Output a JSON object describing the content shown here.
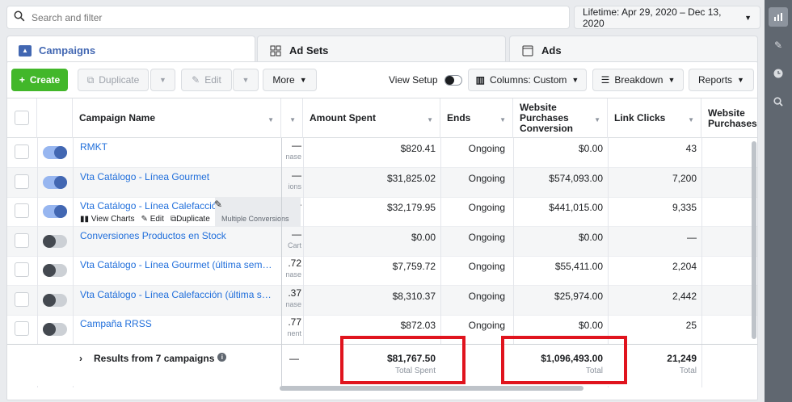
{
  "search": {
    "placeholder": "Search and filter"
  },
  "date_range": {
    "label": "Lifetime: Apr 29, 2020 – Dec 13, 2020"
  },
  "tabs": [
    {
      "label": "Campaigns",
      "icon": "folder-icon",
      "active": true
    },
    {
      "label": "Ad Sets",
      "icon": "grid-icon",
      "active": false
    },
    {
      "label": "Ads",
      "icon": "ad-icon",
      "active": false
    }
  ],
  "toolbar": {
    "create": "Create",
    "duplicate": "Duplicate",
    "edit": "Edit",
    "more": "More",
    "view_setup": "View Setup",
    "columns": "Columns: Custom",
    "breakdown": "Breakdown",
    "reports": "Reports"
  },
  "columns": {
    "campaign_name": "Campaign Name",
    "amount_spent": "Amount Spent",
    "ends": "Ends",
    "website_purchases_conversion": "Website Purchases Conversion",
    "link_clicks": "Link Clicks",
    "website_purchases": "Website Purchases"
  },
  "rows": [
    {
      "name": "RMKT",
      "frag_top": "—",
      "frag_bot": "nase",
      "amount_spent": "$820.41",
      "ends": "Ongoing",
      "conversion": "$0.00",
      "link_clicks": "43",
      "on": true
    },
    {
      "name": "Vta Catálogo - Línea Gourmet",
      "frag_top": "—",
      "frag_bot": "ions",
      "amount_spent": "$31,825.02",
      "ends": "Ongoing",
      "conversion": "$574,093.00",
      "link_clicks": "7,200",
      "on": true
    },
    {
      "name": "Vta Catálogo - Línea Calefacción",
      "frag_top": "—",
      "frag_bot": "",
      "amount_spent": "$32,179.95",
      "ends": "Ongoing",
      "conversion": "$441,015.00",
      "link_clicks": "9,335",
      "on": true
    },
    {
      "name": "Conversiones Productos en Stock",
      "frag_top": "—",
      "frag_bot": "Cart",
      "amount_spent": "$0.00",
      "ends": "Ongoing",
      "conversion": "$0.00",
      "link_clicks": "—",
      "on": false
    },
    {
      "name": "Vta Catálogo - Línea Gourmet (última seman...",
      "frag_top": ".72",
      "frag_bot": "nase",
      "amount_spent": "$7,759.72",
      "ends": "Ongoing",
      "conversion": "$55,411.00",
      "link_clicks": "2,204",
      "on": false
    },
    {
      "name": "Vta Catálogo - Línea Calefacción (última sem...",
      "frag_top": ".37",
      "frag_bot": "nase",
      "amount_spent": "$8,310.37",
      "ends": "Ongoing",
      "conversion": "$25,974.00",
      "link_clicks": "2,442",
      "on": false
    },
    {
      "name": "Campaña RRSS",
      "frag_top": ".77",
      "frag_bot": "nent",
      "amount_spent": "$872.03",
      "ends": "Ongoing",
      "conversion": "$0.00",
      "link_clicks": "25",
      "on": false
    }
  ],
  "row_hover": {
    "view_charts": "View Charts",
    "edit": "Edit",
    "duplicate": "Duplicate",
    "tooltip": "Multiple Conversions"
  },
  "totals": {
    "label": "Results from 7 campaigns",
    "frag": "—",
    "amount_spent": "$81,767.50",
    "amount_spent_sub": "Total Spent",
    "conversion": "$1,096,493.00",
    "conversion_sub": "Total",
    "link_clicks": "21,249",
    "link_clicks_sub": "Total"
  },
  "rail_icons": [
    "bar-chart-icon",
    "pencil-icon",
    "clock-icon",
    "magnifier-icon"
  ],
  "colors": {
    "accent": "#4267b2",
    "create": "#42b72a",
    "highlight": "#e0141e",
    "link": "#216fdb"
  }
}
